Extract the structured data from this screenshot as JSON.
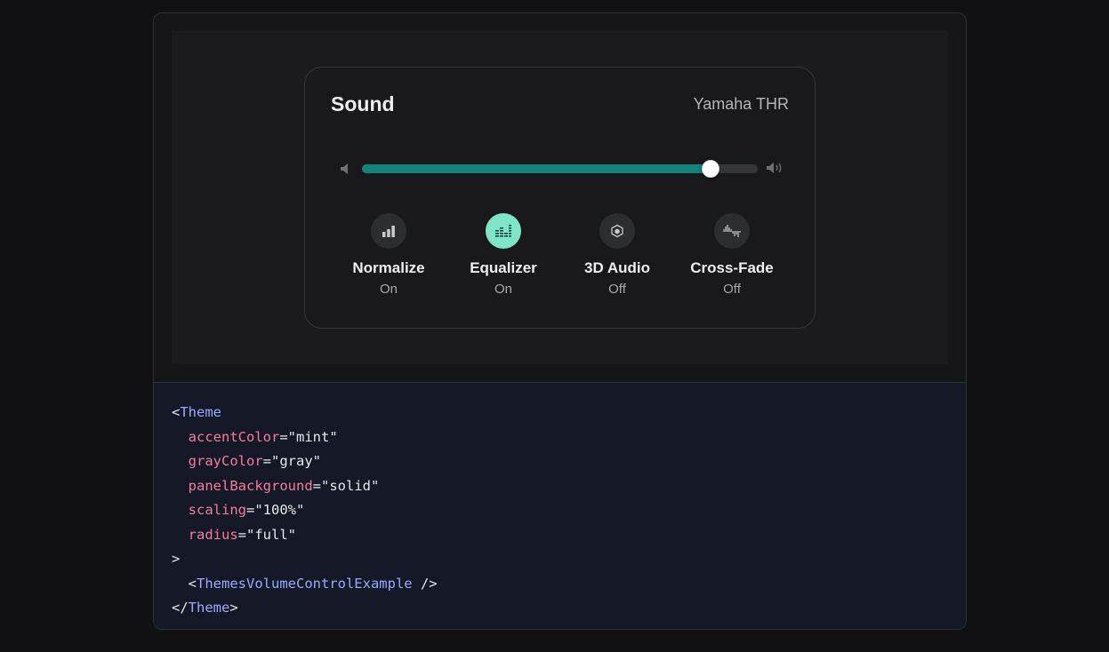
{
  "card": {
    "title": "Sound",
    "device": "Yamaha THR"
  },
  "volume": {
    "value_percent": 88,
    "low_icon": "speaker-low-icon",
    "high_icon": "speaker-high-icon"
  },
  "toggles": [
    {
      "label": "Normalize",
      "state": "On",
      "icon": "bar-chart-icon",
      "active": false
    },
    {
      "label": "Equalizer",
      "state": "On",
      "icon": "equalizer-icon",
      "active": true
    },
    {
      "label": "3D Audio",
      "state": "Off",
      "icon": "cube-icon",
      "active": false
    },
    {
      "label": "Cross-Fade",
      "state": "Off",
      "icon": "waveform-icon",
      "active": false
    }
  ],
  "code": {
    "open_tag": "Theme",
    "attrs": [
      {
        "name": "accentColor",
        "value": "\"mint\""
      },
      {
        "name": "grayColor",
        "value": "\"gray\""
      },
      {
        "name": "panelBackground",
        "value": "\"solid\""
      },
      {
        "name": "scaling",
        "value": "\"100%\""
      },
      {
        "name": "radius",
        "value": "\"full\""
      }
    ],
    "child_tag": "ThemesVolumeControlExample",
    "close_tag": "Theme"
  },
  "colors": {
    "accent": "#12847a",
    "accent_light": "#7ee5c9",
    "code_tag": "#9aa9ff",
    "code_attr": "#f47c9e"
  }
}
